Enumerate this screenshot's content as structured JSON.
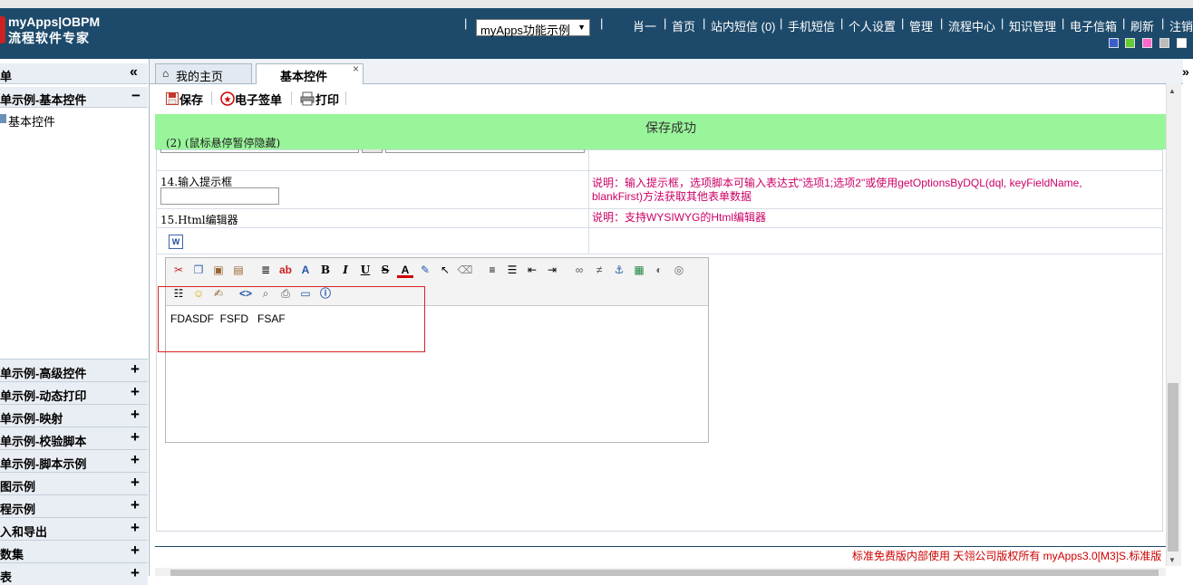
{
  "header": {
    "logo_line1": "myApps|OBPM",
    "logo_line2": "流程软件专家",
    "app_select": "myApps功能示例",
    "links": [
      "肖一",
      "首页",
      "站内短信 (0)",
      "手机短信",
      "个人设置",
      "管理",
      "流程中心",
      "知识管理",
      "电子信箱",
      "刷新",
      "注销"
    ],
    "theme_colors": [
      "#3a5fcd",
      "#66cc33",
      "#ff66cc",
      "#bbbbbb",
      "#ffffff"
    ]
  },
  "sidebar": {
    "head": "单",
    "collapse_icon": "«",
    "expanded_section": "单示例-基本控件",
    "leaf": "基本控件",
    "sections": [
      "单示例-高级控件",
      "单示例-动态打印",
      "单示例-映射",
      "单示例-校验脚本",
      "单示例-脚本示例",
      "图示例",
      "程示例",
      "入和导出",
      "数集",
      "表"
    ]
  },
  "tabs": {
    "home": "我的主页",
    "current": "基本控件",
    "close": "×",
    "chevron": "»"
  },
  "toolbar": {
    "save": "保存",
    "sign": "电子签单",
    "print": "打印"
  },
  "status": {
    "success": "保存成功",
    "hover_hint": "(2) (鼠标悬停暂停隐藏)"
  },
  "form": {
    "row14_label": "14.输入提示框",
    "row14_desc_1": "说明：输入提示框，选项脚本可输入表达式\"选项1;选项2\"或使用getOptionsByDQL(dql, keyFieldName,",
    "row14_desc_2": "blankFirst)方法获取其他表单数据",
    "row14_value": "",
    "row15_label": "15.Html编辑器",
    "row15_desc": "说明：支持WYSIWYG的Html编辑器",
    "word_icon": "W"
  },
  "editor": {
    "content": "FDASDF  FSFD   FSAF",
    "tools_row1": [
      "cut-icon",
      "copy-icon",
      "paste-icon",
      "paste-text-icon",
      "format-icon",
      "style-icon",
      "font-size-icon",
      "bold-icon",
      "italic-icon",
      "underline-icon",
      "strike-icon",
      "font-color-icon",
      "highlight-icon",
      "select-icon",
      "eraser-icon",
      "align-icon",
      "list-icon",
      "outdent-icon",
      "indent-icon",
      "link-icon",
      "unlink-icon",
      "anchor-icon",
      "image-icon",
      "flash-icon",
      "media-icon"
    ],
    "tools_row2": [
      "ordered-list-icon",
      "smiley-icon",
      "edit-icon",
      "source-icon",
      "preview-icon",
      "print-icon",
      "fullscreen-icon",
      "info-icon"
    ]
  },
  "footer": {
    "text": "标准免费版内部使用  天翎公司版权所有 myApps3.0[M3]S.标准版"
  }
}
